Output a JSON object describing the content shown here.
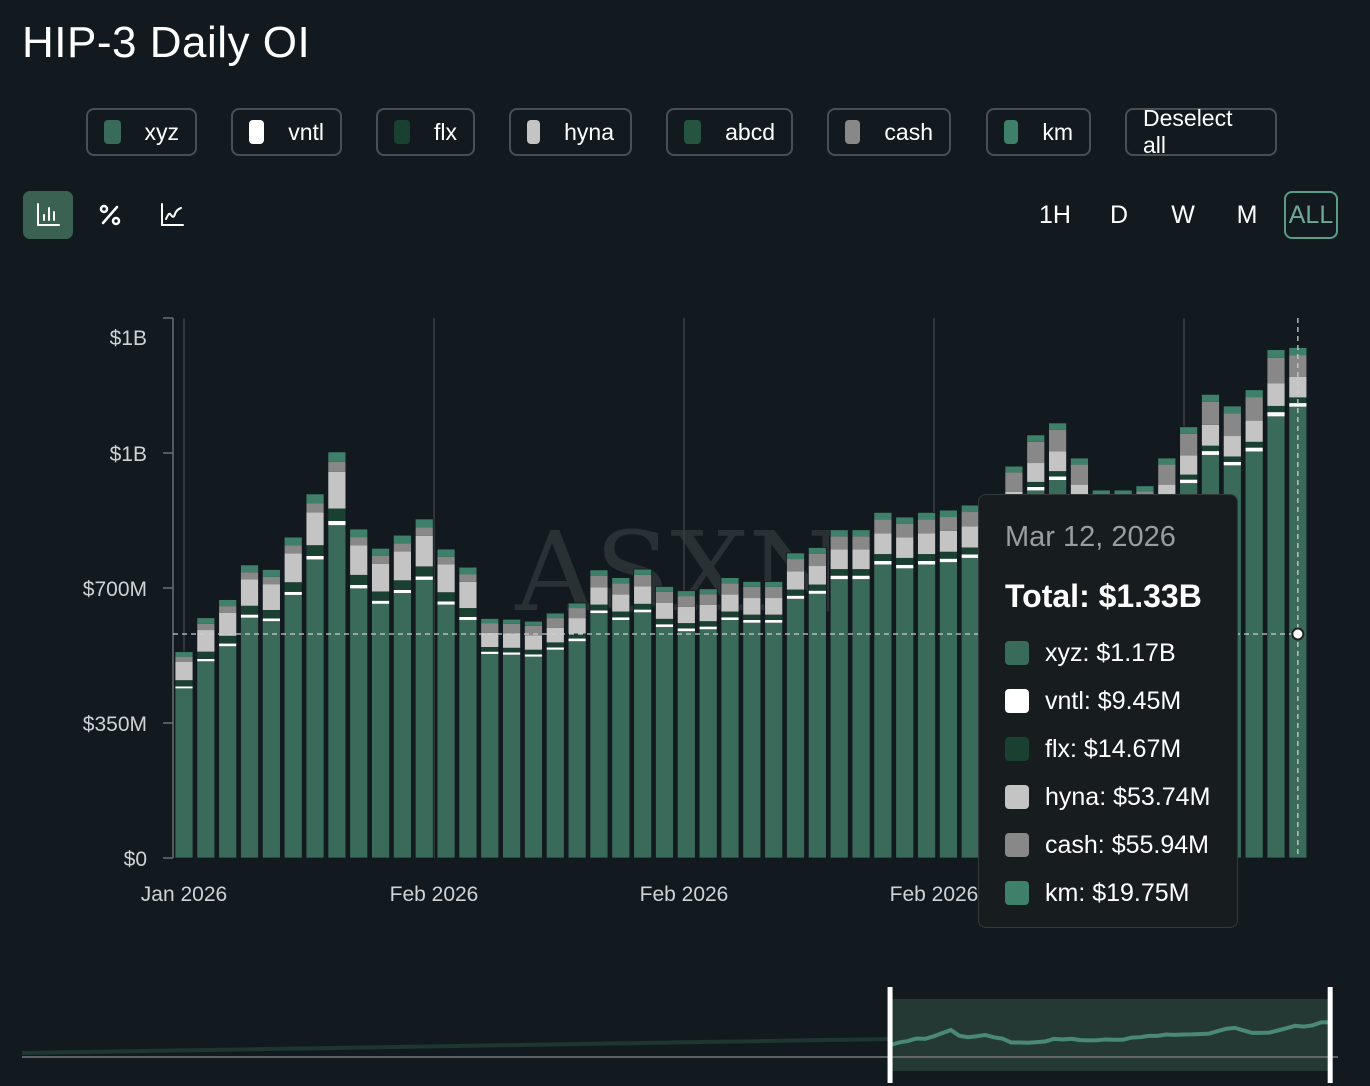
{
  "title": "HIP-3 Daily OI",
  "legend": [
    {
      "label": "xyz",
      "color": "#3a6b5a"
    },
    {
      "label": "vntl",
      "color": "#ffffff"
    },
    {
      "label": "flx",
      "color": "#1a4032"
    },
    {
      "label": "hyna",
      "color": "#c4c4c4"
    },
    {
      "label": "abcd",
      "color": "#255440"
    },
    {
      "label": "cash",
      "color": "#888888"
    },
    {
      "label": "km",
      "color": "#3f806a"
    }
  ],
  "deselect_label": "Deselect all",
  "chart_types": [
    {
      "icon": "bar-chart-icon",
      "active": true
    },
    {
      "icon": "percent-icon",
      "active": false
    },
    {
      "icon": "line-chart-icon",
      "active": false
    }
  ],
  "ranges": [
    {
      "label": "1H",
      "active": false
    },
    {
      "label": "D",
      "active": false
    },
    {
      "label": "W",
      "active": false
    },
    {
      "label": "M",
      "active": false
    },
    {
      "label": "ALL",
      "active": true
    }
  ],
  "watermark": "ASXN",
  "tooltip": {
    "date": "Mar 12, 2026",
    "total": "Total: $1.33B",
    "rows": [
      {
        "label": "xyz: $1.17B",
        "color": "#3a6b5a"
      },
      {
        "label": "vntl: $9.45M",
        "color": "#ffffff"
      },
      {
        "label": "flx: $14.67M",
        "color": "#1a4032"
      },
      {
        "label": "hyna: $53.74M",
        "color": "#c4c4c4"
      },
      {
        "label": "cash: $55.94M",
        "color": "#888888"
      },
      {
        "label": "km: $19.75M",
        "color": "#3f806a"
      }
    ]
  },
  "chart_data": {
    "type": "bar",
    "stacked": true,
    "title": "HIP-3 Daily OI",
    "ylim": [
      0,
      1400
    ],
    "yunit": "USD millions",
    "yticks": [
      0,
      350,
      700,
      1050,
      1400
    ],
    "ytick_labels": [
      "$0",
      "$350M",
      "$700M",
      "$1B",
      "$1B"
    ],
    "xtick_labels": [
      "Jan 2026",
      "Feb 2026",
      "Feb 2026",
      "Feb 2026",
      "Feb 2026"
    ],
    "grid": "vertical",
    "last_date": "Mar 12, 2026",
    "series": [
      {
        "name": "xyz",
        "color": "#3a6b5a",
        "values": [
          440,
          510,
          549,
          623,
          614,
          682,
          774,
          863,
          699,
          659,
          687,
          721,
          657,
          617,
          529,
          527,
          522,
          540,
          562,
          635,
          617,
          637,
          599,
          588,
          593,
          617,
          610,
          610,
          672,
          685,
          723,
          723,
          761,
          751,
          761,
          767,
          778,
          789,
          883,
          953,
          980,
          901,
          829,
          829,
          839,
          901,
          972,
          1045,
          1018,
          1054,
          1145,
          1170
        ]
      },
      {
        "name": "vntl",
        "color": "#ffffff",
        "values": [
          5,
          6,
          7,
          8,
          7,
          8,
          9,
          11,
          9,
          8,
          8,
          9,
          8,
          8,
          6,
          6,
          6,
          6,
          7,
          7,
          7,
          7,
          7,
          7,
          7,
          7,
          7,
          7,
          8,
          8,
          9,
          9,
          9,
          9,
          9,
          9,
          9,
          9,
          8,
          9,
          9,
          8,
          8,
          8,
          8,
          8,
          9,
          10,
          9,
          10,
          11,
          9.45
        ]
      },
      {
        "name": "flx",
        "color": "#1a4032",
        "values": [
          16,
          19,
          20,
          23,
          22,
          25,
          28,
          32,
          26,
          24,
          25,
          26,
          24,
          23,
          12,
          12,
          12,
          13,
          13,
          15,
          15,
          15,
          14,
          14,
          14,
          15,
          14,
          14,
          16,
          16,
          17,
          17,
          18,
          18,
          18,
          18,
          18,
          19,
          12,
          13,
          14,
          12,
          11,
          11,
          12,
          12,
          13,
          14,
          14,
          15,
          16,
          14.67
        ]
      },
      {
        "name": "hyna",
        "color": "#c4c4c4",
        "values": [
          48,
          56,
          60,
          68,
          67,
          75,
          85,
          95,
          77,
          72,
          75,
          79,
          72,
          68,
          37,
          37,
          37,
          38,
          40,
          45,
          44,
          45,
          42,
          42,
          42,
          44,
          43,
          43,
          47,
          48,
          51,
          51,
          54,
          53,
          54,
          54,
          55,
          56,
          46,
          49,
          51,
          47,
          43,
          43,
          43,
          47,
          50,
          54,
          53,
          55,
          59,
          53.74
        ]
      },
      {
        "name": "cash",
        "color": "#888888",
        "values": [
          13,
          16,
          17,
          19,
          19,
          21,
          24,
          26,
          21,
          20,
          21,
          22,
          20,
          19,
          25,
          25,
          25,
          25,
          26,
          30,
          29,
          30,
          28,
          28,
          28,
          29,
          29,
          29,
          32,
          32,
          34,
          34,
          36,
          35,
          36,
          36,
          37,
          37,
          51,
          55,
          56,
          52,
          48,
          48,
          48,
          52,
          56,
          60,
          59,
          61,
          66,
          55.94
        ]
      },
      {
        "name": "km",
        "color": "#3f806a",
        "values": [
          13,
          16,
          17,
          19,
          19,
          21,
          24,
          26,
          21,
          20,
          21,
          22,
          20,
          19,
          12,
          12,
          12,
          13,
          13,
          15,
          15,
          15,
          14,
          14,
          14,
          15,
          14,
          14,
          16,
          16,
          17,
          17,
          18,
          18,
          18,
          18,
          18,
          19,
          16,
          18,
          18,
          17,
          15,
          15,
          15,
          17,
          18,
          19,
          19,
          19,
          21,
          19.75
        ]
      }
    ],
    "hover_index": 51,
    "brush_range": [
      0.66,
      0.98
    ]
  }
}
